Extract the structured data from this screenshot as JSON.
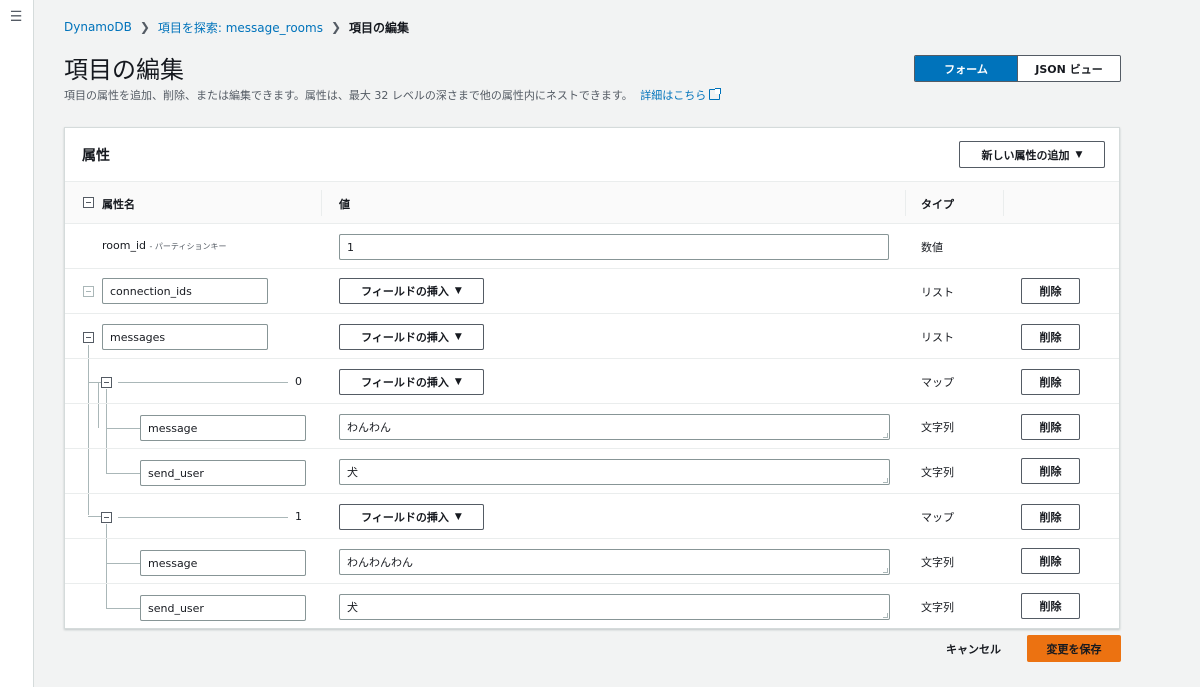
{
  "nav": {
    "menu_icon": "hamburger-icon",
    "menu_glyph": "☰"
  },
  "breadcrumb": {
    "items": [
      "DynamoDB",
      "項目を探索: message_rooms",
      "項目の編集"
    ],
    "separator": "❯"
  },
  "header": {
    "title": "項目の編集",
    "description": "項目の属性を追加、削除、または編集できます。属性は、最大 32 レベルの深さまで他の属性内にネストできます。",
    "learn_more": "詳細はこちら",
    "view_modes": [
      "フォーム",
      "JSON ビュー"
    ],
    "active_view": "フォーム"
  },
  "panel": {
    "title": "属性",
    "add_button": "新しい属性の追加",
    "dropdown_glyph": "▼",
    "columns": {
      "name": "属性名",
      "value": "値",
      "type": "タイプ"
    }
  },
  "rows": [
    {
      "name": "room_id",
      "key_label": "- パーティションキー",
      "value": "1",
      "type": "数値"
    },
    {
      "name": "connection_ids",
      "insert_label": "フィールドの挿入",
      "type": "リスト",
      "delete": "削除"
    },
    {
      "name": "messages",
      "insert_label": "フィールドの挿入",
      "type": "リスト",
      "delete": "削除"
    },
    {
      "index": "0",
      "insert_label": "フィールドの挿入",
      "type": "マップ",
      "delete": "削除"
    },
    {
      "name": "message",
      "value": "わんわん",
      "type": "文字列",
      "delete": "削除"
    },
    {
      "name": "send_user",
      "value": "犬",
      "type": "文字列",
      "delete": "削除"
    },
    {
      "index": "1",
      "insert_label": "フィールドの挿入",
      "type": "マップ",
      "delete": "削除"
    },
    {
      "name": "message",
      "value": "わんわんわん",
      "type": "文字列",
      "delete": "削除"
    },
    {
      "name": "send_user",
      "value": "犬",
      "type": "文字列",
      "delete": "削除"
    }
  ],
  "footer": {
    "cancel": "キャンセル",
    "save": "変更を保存"
  },
  "colors": {
    "primary": "#0073bb",
    "save": "#ec7211",
    "background": "#f2f3f3"
  }
}
